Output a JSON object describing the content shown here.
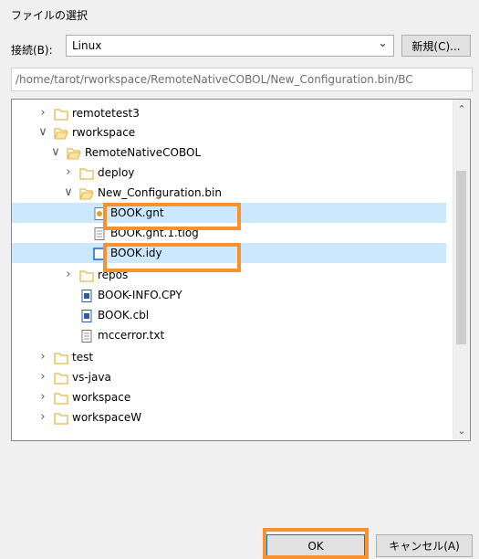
{
  "dialog": {
    "title": "ファイルの選択"
  },
  "connection": {
    "label": "接続(B):",
    "value": "Linux",
    "new_button": "新規(C)..."
  },
  "path": "/home/tarot/rworkspace/RemoteNativeCOBOL/New_Configuration.bin/BC",
  "tree": {
    "items": [
      {
        "label": "remotetest3",
        "icon": "folder-icon",
        "expander": "collapsed"
      },
      {
        "label": "rworkspace",
        "icon": "folder-open-icon",
        "expander": "expanded"
      },
      {
        "label": "RemoteNativeCOBOL",
        "icon": "folder-open-icon",
        "expander": "expanded"
      },
      {
        "label": "deploy",
        "icon": "folder-icon",
        "expander": "collapsed"
      },
      {
        "label": "New_Configuration.bin",
        "icon": "folder-open-icon",
        "expander": "expanded"
      },
      {
        "label": "BOOK.gnt",
        "icon": "gnt-file-icon",
        "expander": "none",
        "selected": true
      },
      {
        "label": "BOOK.gnt.1.tlog",
        "icon": "text-file-icon",
        "expander": "none"
      },
      {
        "label": "BOOK.idy",
        "icon": "idy-file-icon",
        "expander": "none",
        "selected": true
      },
      {
        "label": "repos",
        "icon": "folder-icon",
        "expander": "collapsed"
      },
      {
        "label": "BOOK-INFO.CPY",
        "icon": "cobol-file-icon",
        "expander": "none"
      },
      {
        "label": "BOOK.cbl",
        "icon": "cobol-file-icon",
        "expander": "none"
      },
      {
        "label": "mccerror.txt",
        "icon": "text-file-icon",
        "expander": "none"
      },
      {
        "label": "test",
        "icon": "folder-icon",
        "expander": "collapsed"
      },
      {
        "label": "vs-java",
        "icon": "folder-icon",
        "expander": "collapsed"
      },
      {
        "label": "workspace",
        "icon": "folder-icon",
        "expander": "collapsed"
      },
      {
        "label": "workspaceW",
        "icon": "folder-icon",
        "expander": "collapsed"
      }
    ]
  },
  "buttons": {
    "ok": "OK",
    "cancel": "キャンセル(A)"
  },
  "colors": {
    "selection": "#cce8ff",
    "highlight": "#f7922e",
    "folder": "#e8b84a"
  }
}
